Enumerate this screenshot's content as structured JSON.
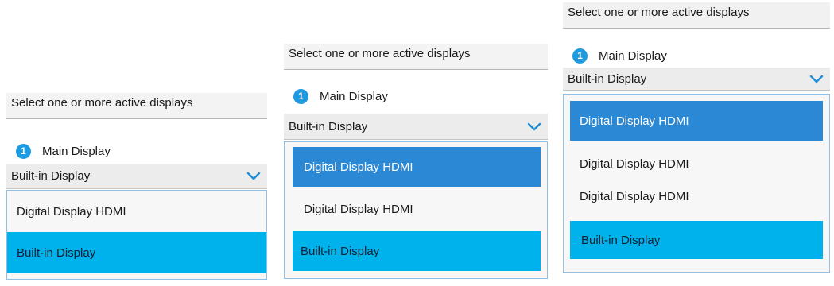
{
  "panels": [
    {
      "header": "Select one or more active displays",
      "display": {
        "badge": "1",
        "label": "Main Display"
      },
      "select_value": "Built-in Display",
      "options": [
        {
          "label": "Digital Display HDMI",
          "highlight": "none"
        },
        {
          "label": "Built-in Display",
          "highlight": "light"
        }
      ]
    },
    {
      "header": "Select one or more active displays",
      "display": {
        "badge": "1",
        "label": "Main Display"
      },
      "select_value": "Built-in Display",
      "options": [
        {
          "label": "Digital Display HDMI",
          "highlight": "dark"
        },
        {
          "label": "Digital Display HDMI",
          "highlight": "none"
        },
        {
          "label": "Built-in Display",
          "highlight": "light"
        }
      ]
    },
    {
      "header": "Select one or more active displays",
      "display": {
        "badge": "1",
        "label": "Main Display"
      },
      "select_value": "Built-in Display",
      "options": [
        {
          "label": "Digital Display HDMI",
          "highlight": "dark"
        },
        {
          "label": "Digital Display HDMI",
          "highlight": "none"
        },
        {
          "label": "Digital Display HDMI",
          "highlight": "none"
        },
        {
          "label": "Built-in Display",
          "highlight": "light"
        }
      ]
    }
  ],
  "colors": {
    "badge": "#1e9be0",
    "chevron": "#1e8fd8",
    "highlight_dark": "#2b88d4",
    "highlight_light": "#00b2ec"
  },
  "icons": {
    "badge": "number-badge-icon",
    "chevron": "chevron-down-icon"
  }
}
